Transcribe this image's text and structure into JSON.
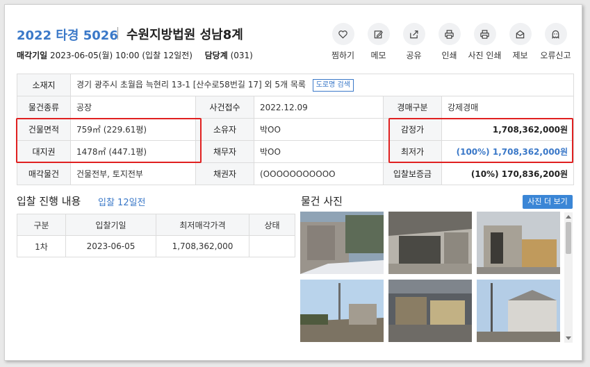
{
  "header": {
    "case_no": "2022 타경 5026",
    "court": "수원지방법원 성남8계",
    "sale_date_label": "매각기일",
    "sale_date_value": "2023-06-05(월) 10:00 (입찰 12일전)",
    "officer_label": "담당계",
    "officer_value": "(031)"
  },
  "actions": [
    {
      "label": "찜하기",
      "icon": "heart-icon"
    },
    {
      "label": "메모",
      "icon": "memo-icon"
    },
    {
      "label": "공유",
      "icon": "share-icon"
    },
    {
      "label": "인쇄",
      "icon": "print-icon"
    },
    {
      "label": "사진 인쇄",
      "icon": "photo-print-icon"
    },
    {
      "label": "제보",
      "icon": "report-icon"
    },
    {
      "label": "오류신고",
      "icon": "error-report-icon"
    }
  ],
  "info": {
    "location_label": "소재지",
    "location_value": "경기 광주시 초월읍 늑현리 13-1 [산수로58번길 17] 외 5개 목록",
    "road_search": "도로명 검색",
    "type_label": "물건종류",
    "type_value": "공장",
    "received_label": "사건접수",
    "received_value": "2022.12.09",
    "sale_kind_label": "경매구분",
    "sale_kind_value": "강제경매",
    "building_area_label": "건물면적",
    "building_area_value": "759㎡ (229.61평)",
    "owner_label": "소유자",
    "owner_value": "박OO",
    "appraisal_label": "감정가",
    "appraisal_value": "1,708,362,000원",
    "land_label": "대지권",
    "land_value": "1478㎡ (447.1평)",
    "debtor_label": "채무자",
    "debtor_value": "박OO",
    "min_price_label": "최저가",
    "min_price_value": "(100%) 1,708,362,000원",
    "sale_item_label": "매각물건",
    "sale_item_value": "건물전부, 토지전부",
    "creditor_label": "채권자",
    "creditor_value": "(OOOOOOOOOOO",
    "deposit_label": "입찰보증금",
    "deposit_value": "(10%) 170,836,200원"
  },
  "bids": {
    "title": "입찰 진행 내용",
    "subtitle": "입찰 12일전",
    "headers": [
      "구분",
      "입찰기일",
      "최저매각가격",
      "상태"
    ],
    "rows": [
      [
        "1차",
        "2023-06-05",
        "1,708,362,000",
        ""
      ]
    ]
  },
  "photos": {
    "title": "물건 사진",
    "more_button": "사진 더 보기"
  },
  "colors": {
    "accent": "#3a78c8",
    "highlight_box": "#e02020",
    "button": "#3b86d6"
  }
}
